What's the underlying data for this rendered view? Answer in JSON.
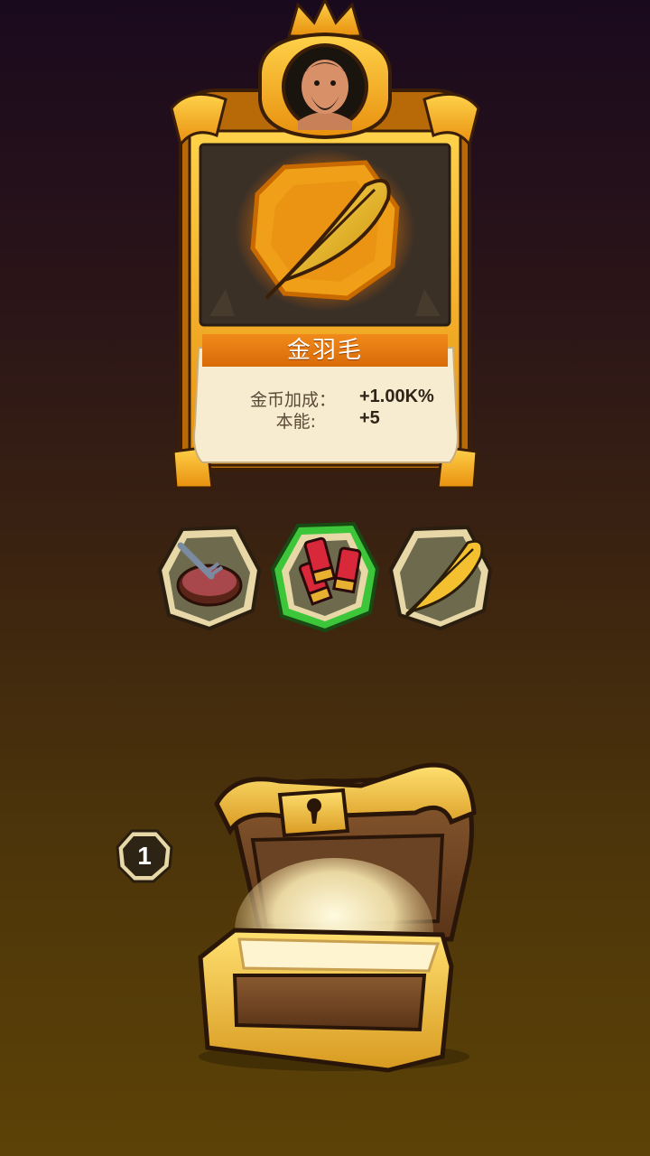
{
  "item_card": {
    "name": "金羽毛",
    "portrait_icon": "bearded-hunter-portrait",
    "item_icon": "golden-feather-icon",
    "stats": [
      {
        "label": "金币加成：",
        "value": "+1.00K%"
      },
      {
        "label": "本能:",
        "value": "+5"
      }
    ]
  },
  "reward_items": [
    {
      "icon": "steak-with-fork-icon",
      "selected": false
    },
    {
      "icon": "shotgun-shells-icon",
      "selected": true
    },
    {
      "icon": "golden-feather-icon",
      "selected": false
    }
  ],
  "chest": {
    "icon": "open-treasure-chest",
    "remaining_count": "1"
  },
  "colors": {
    "gold": "#f5a623",
    "orange_banner": "#e07810",
    "parchment": "#f7ecd0",
    "selected_ring": "#3ec63a"
  }
}
